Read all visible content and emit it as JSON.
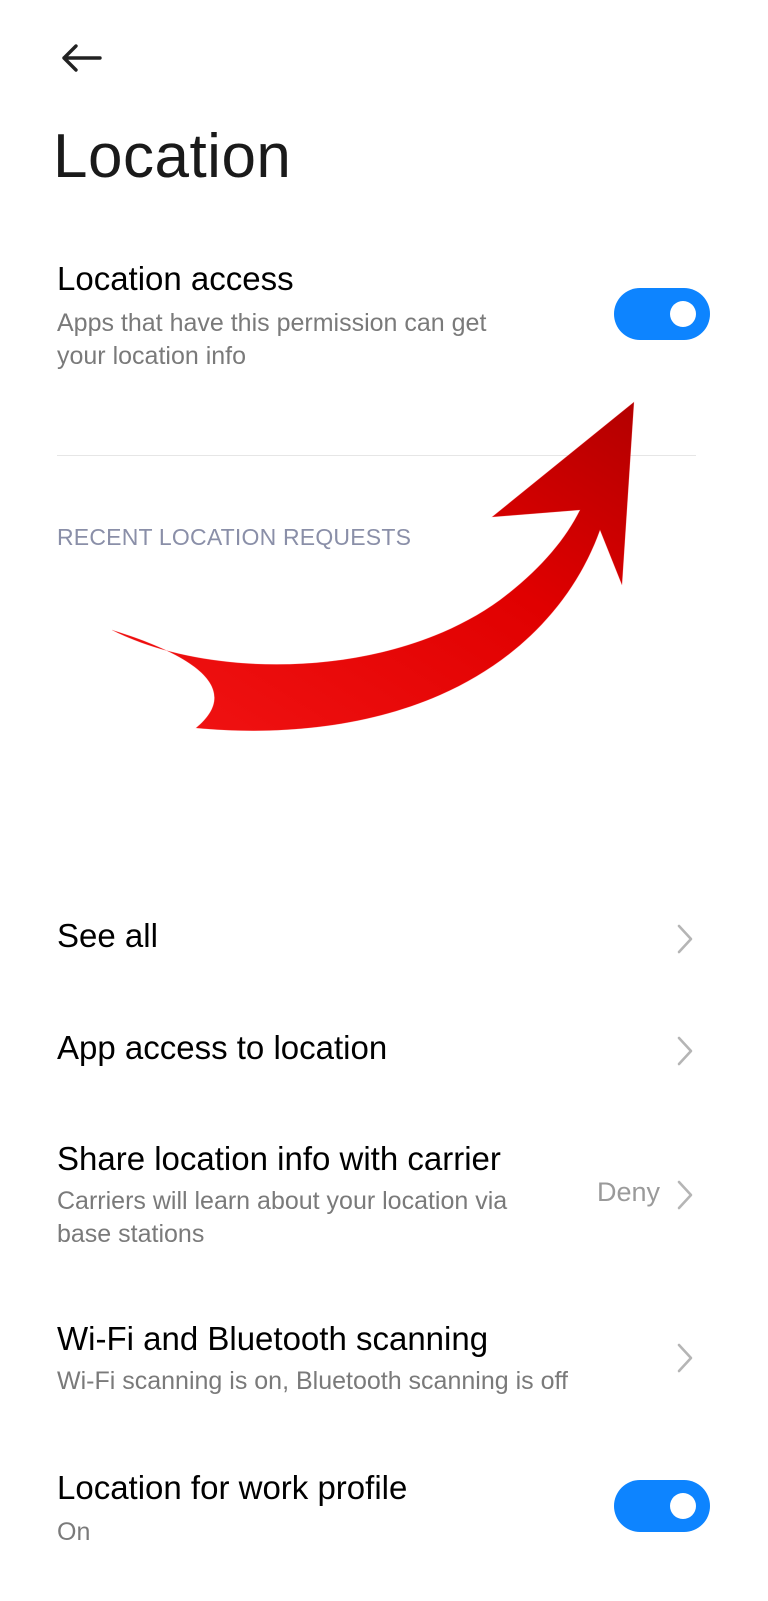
{
  "header": {
    "back_icon": "arrow-left-icon",
    "title": "Location"
  },
  "location_access": {
    "title": "Location access",
    "subtitle_line1": "Apps that have this permission can get",
    "subtitle_line2": "your location info",
    "toggle_on": true
  },
  "recent_requests": {
    "header": "RECENT LOCATION REQUESTS"
  },
  "rows": {
    "see_all": {
      "title": "See all"
    },
    "app_access": {
      "title": "App access to location"
    },
    "share_carrier": {
      "title": "Share location info with carrier",
      "subtitle_line1": "Carriers will learn about your location via",
      "subtitle_line2": "base stations",
      "value": "Deny"
    },
    "wifi_bt": {
      "title": "Wi-Fi and Bluetooth scanning",
      "subtitle": "Wi-Fi scanning is on, Bluetooth scanning is off"
    },
    "work_profile": {
      "title": "Location for work profile",
      "subtitle": "On",
      "toggle_on": true
    }
  },
  "colors": {
    "accent": "#0d84ff",
    "annotation_arrow": "#e60000",
    "section_header": "#8a8fa8"
  }
}
